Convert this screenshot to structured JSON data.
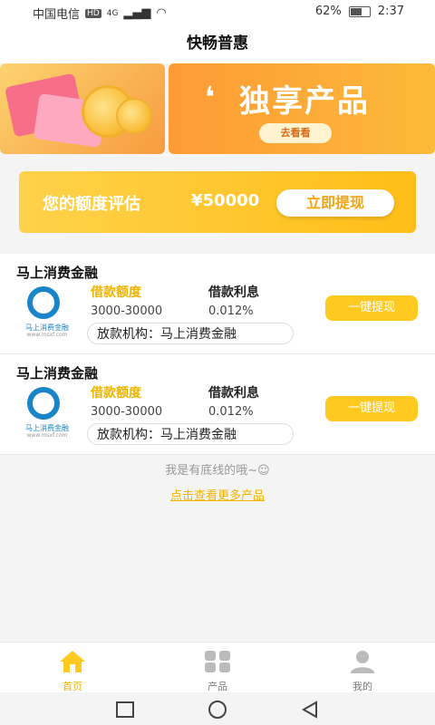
{
  "status_bar": {
    "carrier": "中国电信",
    "hd": "HD",
    "network": "4G",
    "battery": "62%",
    "time": "2:37"
  },
  "header": {
    "title": "快畅普惠"
  },
  "banner": {
    "title": "独享产品",
    "button": "去看看"
  },
  "quota": {
    "label": "您的额度评估",
    "amount": "¥50000",
    "button": "立即提现"
  },
  "products": [
    {
      "name": "马上消费金融",
      "amount_label": "借款额度",
      "interest_label": "借款利息",
      "amount": "3000-30000",
      "interest": "0.012%",
      "org": "放款机构：马上消费金融",
      "button": "一键提现",
      "logo_text": "马上消费金融",
      "logo_url": "www.msxf.com"
    },
    {
      "name": "马上消费金融",
      "amount_label": "借款额度",
      "interest_label": "借款利息",
      "amount": "3000-30000",
      "interest": "0.012%",
      "org": "放款机构：马上消费金融",
      "button": "一键提现",
      "logo_text": "马上消费金融",
      "logo_url": "www.msxf.com"
    }
  ],
  "footer_note": "我是有底线的哦~☺",
  "more_link": "点击查看更多产品",
  "tabs": [
    {
      "label": "首页",
      "active": true,
      "icon": "home-icon"
    },
    {
      "label": "产品",
      "active": false,
      "icon": "grid-icon"
    },
    {
      "label": "我的",
      "active": false,
      "icon": "user-icon"
    }
  ],
  "colors": {
    "accent": "#ffc91f",
    "accent_text": "#f0b400",
    "inactive": "#777777"
  }
}
